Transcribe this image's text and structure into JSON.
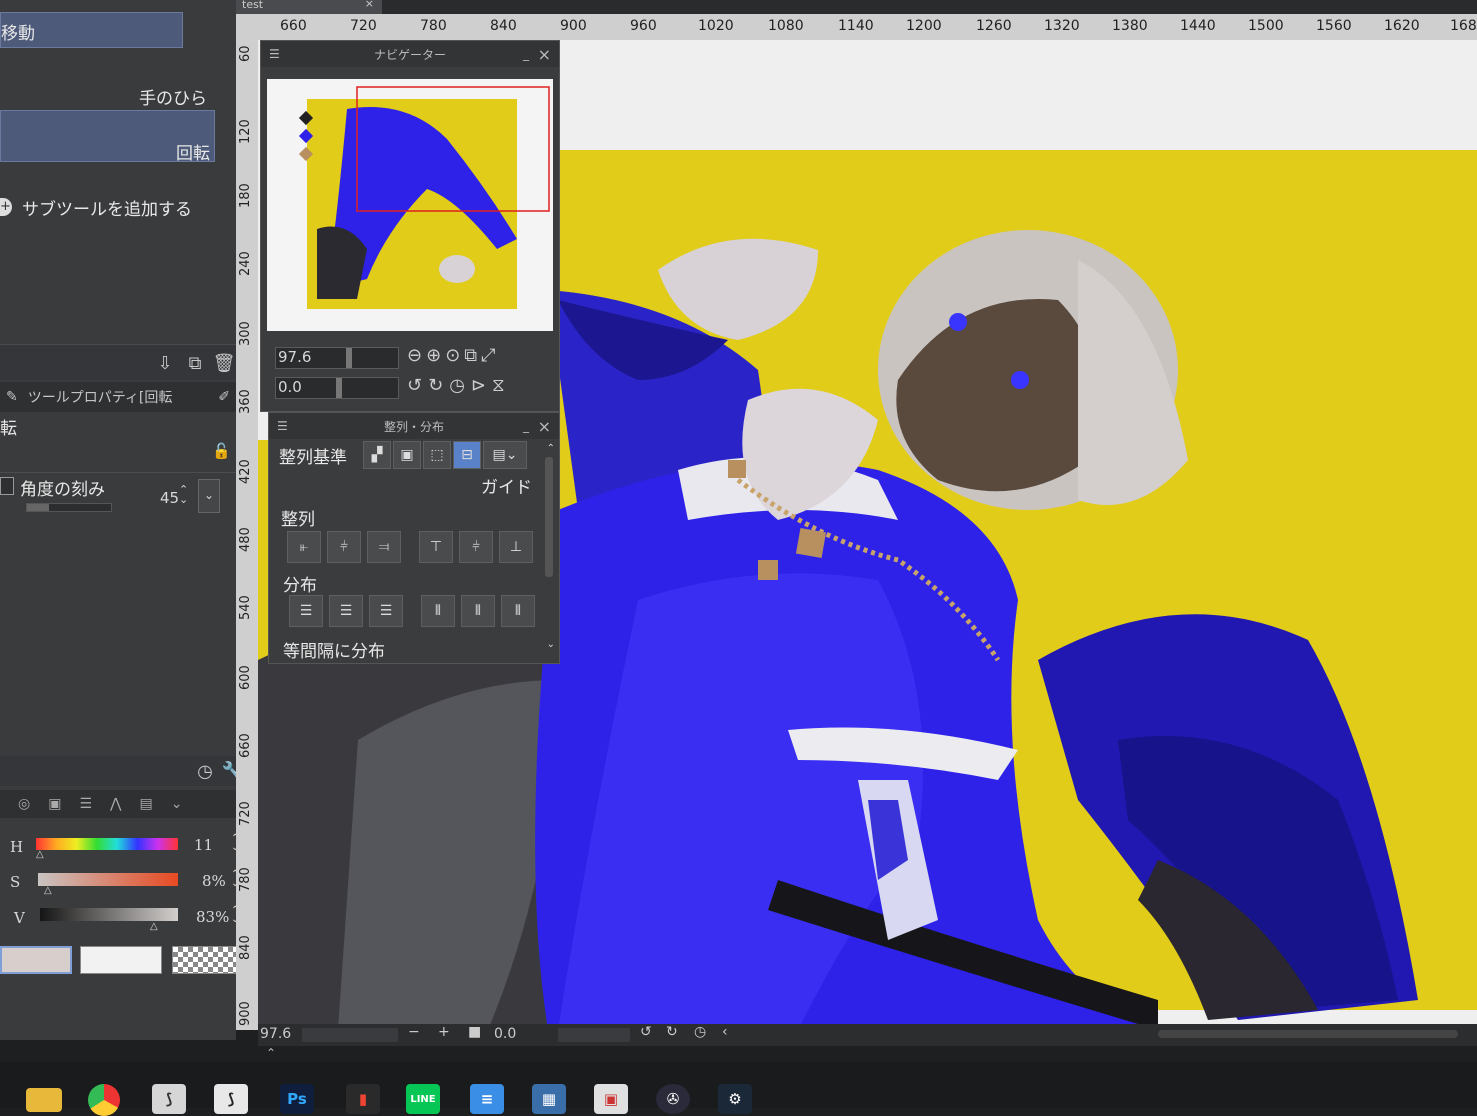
{
  "tab": {
    "title": "test"
  },
  "left_panel": {
    "tool_move": "移動",
    "palm": "手のひら",
    "rotate": "回転",
    "add_subtool": "サブツールを追加する",
    "tool_property_title": "ツールプロパティ[回転",
    "rot_label": "転",
    "angle_step_label": "角度の刻み",
    "angle_step_value": "45"
  },
  "color": {
    "h_label": "H",
    "h_value": "11",
    "s_label": "S",
    "s_value": "8%",
    "v_label": "V",
    "v_value": "83%"
  },
  "ruler": {
    "top": [
      "660",
      "720",
      "780",
      "840",
      "900",
      "960",
      "1020",
      "1080",
      "1140",
      "1200",
      "1260",
      "1320",
      "1380",
      "1440",
      "1500",
      "1560",
      "1620",
      "168"
    ],
    "left": [
      "60",
      "120",
      "180",
      "240",
      "300",
      "360",
      "420",
      "480",
      "540",
      "600",
      "660",
      "720",
      "780",
      "840",
      "900"
    ]
  },
  "navigator": {
    "title": "ナビゲーター",
    "zoom": "97.6",
    "rotation": "0.0"
  },
  "align_panel": {
    "title": "整列・分布",
    "basis_label": "整列基準",
    "guide_label": "ガイド",
    "align_label": "整列",
    "distribute_label": "分布",
    "equal_label": "等間隔に分布"
  },
  "status": {
    "zoom": "97.6",
    "rotation": "0.0"
  },
  "taskbar_items": [
    "explorer",
    "chrome",
    "clip-studio-1",
    "clip-studio-2",
    "Ps",
    "app-red",
    "LINE",
    "notepad",
    "calculator",
    "app-red-2",
    "media",
    "steam"
  ],
  "colors": {
    "canvas_yellow": "#e2cc1a",
    "outfit_blue": "#2e22e8",
    "accent_blue_row": "#4d5a7a"
  }
}
